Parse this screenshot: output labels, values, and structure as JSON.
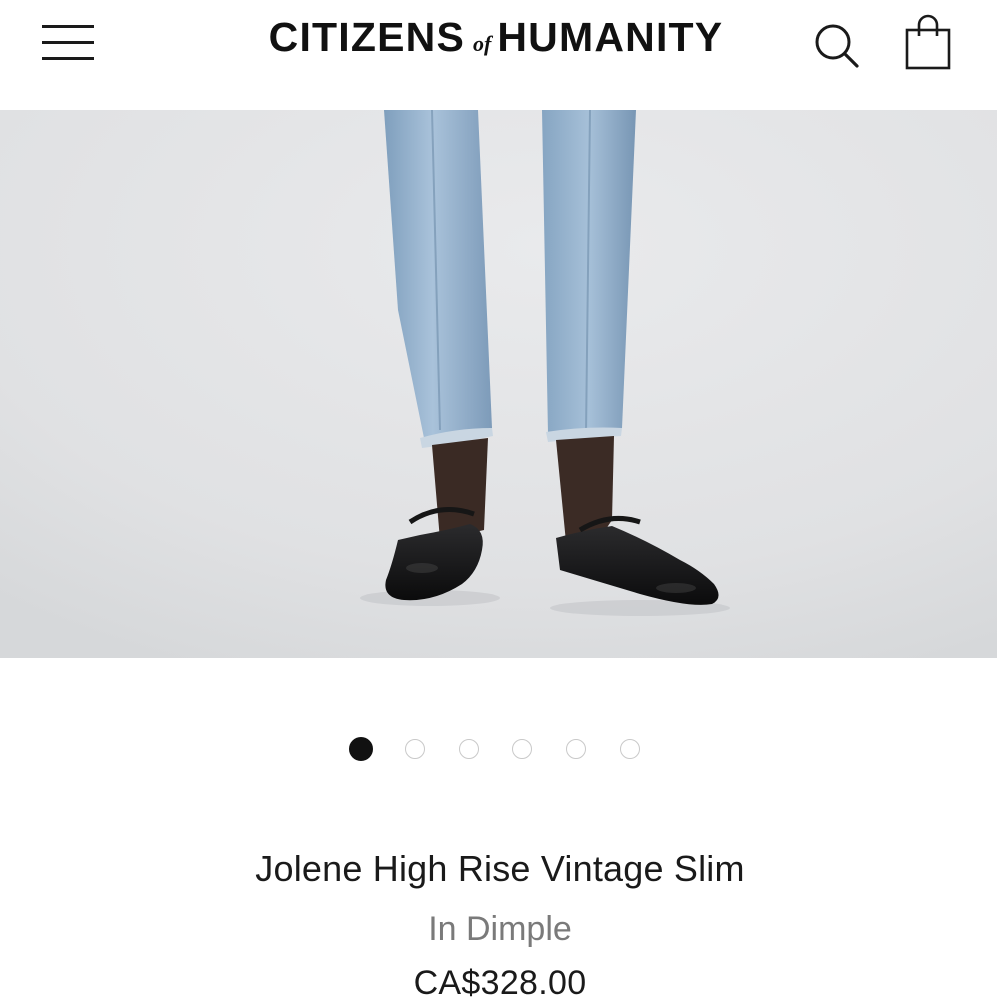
{
  "header": {
    "logo": {
      "part1": "CITIZENS",
      "part2": "of",
      "part3": "HUMANITY"
    },
    "icons": {
      "menu": "hamburger-menu-icon",
      "search": "search-icon",
      "bag": "shopping-bag-icon"
    }
  },
  "gallery": {
    "slide_count": 6,
    "active_slide": 1
  },
  "product": {
    "name": "Jolene High Rise Vintage Slim",
    "variant": "In Dimple",
    "price": "CA$328.00"
  },
  "colors": {
    "text": "#1a1a1a",
    "muted_text": "#7a7a7a",
    "hero_background": "#e2e3e5",
    "denim": "#8fb0cf",
    "active_dot": "#111111",
    "inactive_dot_border": "#c9c9c9"
  }
}
